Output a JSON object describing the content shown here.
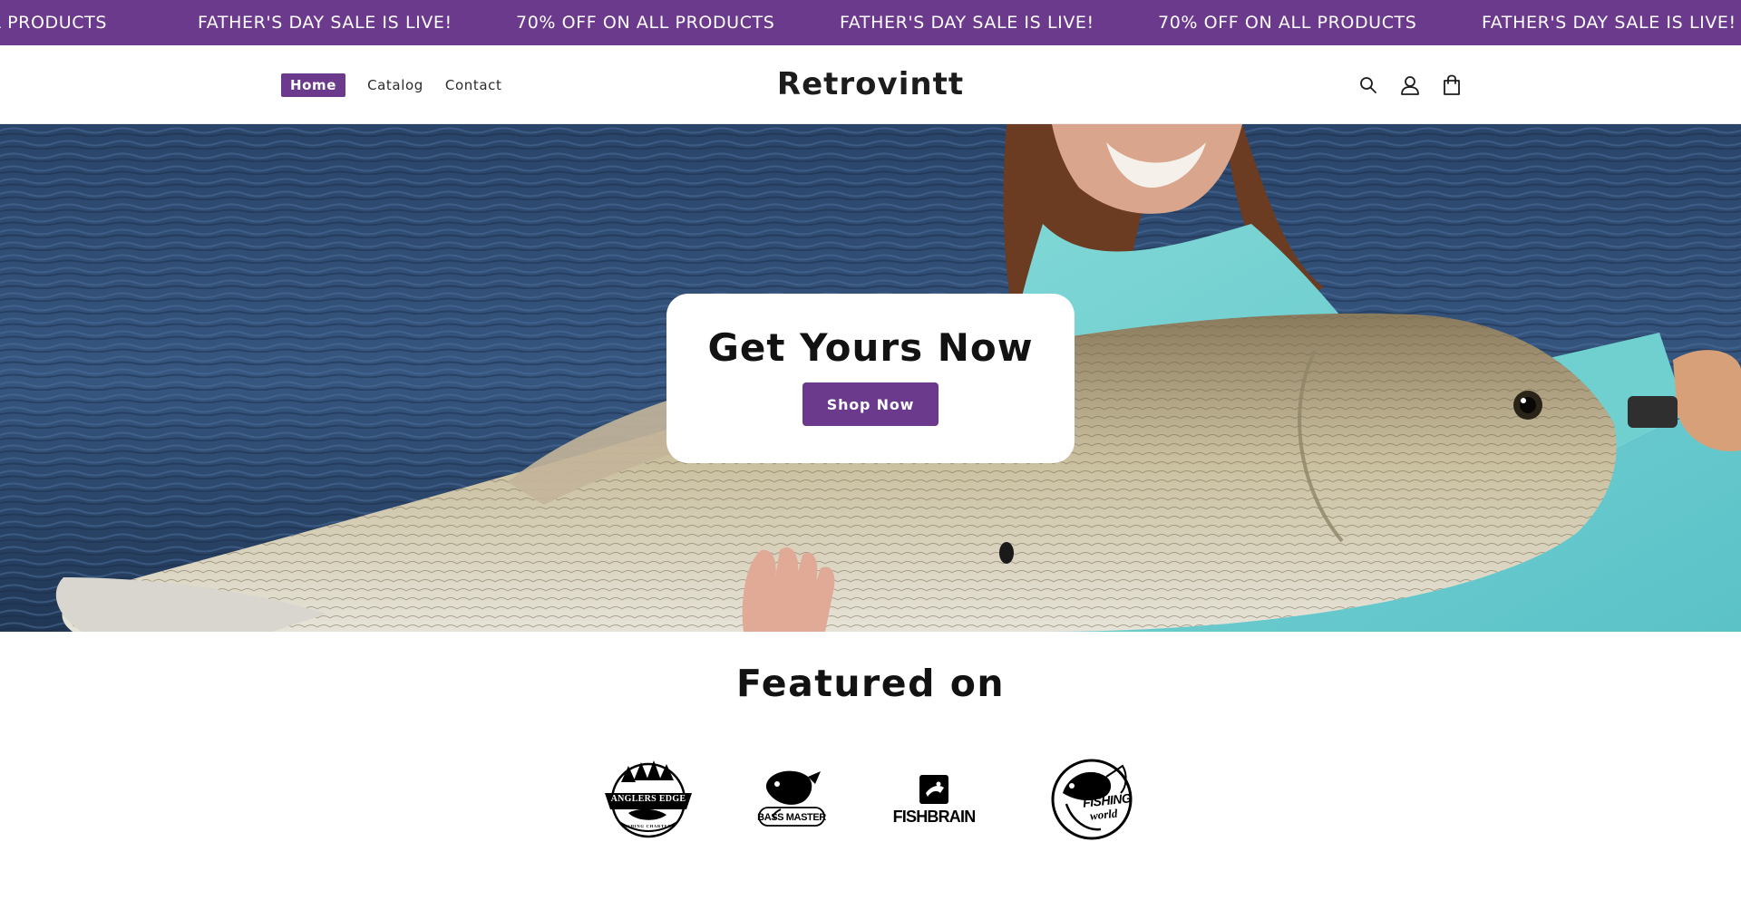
{
  "announcement": {
    "messages": [
      "70% OFF ON ALL PRODUCTS",
      "FATHER'S DAY SALE IS LIVE!",
      "70% OFF ON ALL PRODUCTS",
      "FATHER'S DAY SALE IS LIVE!",
      "70% OFF ON ALL PRODUCTS",
      "FATHER'S DAY SALE IS LIVE!"
    ],
    "background": "#6c3a8c"
  },
  "header": {
    "nav": [
      {
        "label": "Home",
        "active": true
      },
      {
        "label": "Catalog",
        "active": false
      },
      {
        "label": "Contact",
        "active": false
      }
    ],
    "logo": "Retrovintt",
    "icons": [
      "search-icon",
      "account-icon",
      "cart-icon"
    ]
  },
  "hero": {
    "title": "Get Yours Now",
    "button_label": "Shop Now"
  },
  "featured": {
    "title": "Featured on",
    "brands": [
      {
        "name": "ANGLERS EDGE",
        "subtitle": "FISHING CHARTERS"
      },
      {
        "name": "BASS MASTER"
      },
      {
        "name": "FISHBRAIN"
      },
      {
        "name": "FISHING",
        "subtitle": "world"
      }
    ]
  },
  "colors": {
    "accent": "#6c3a8c",
    "text": "#121212",
    "background": "#ffffff"
  }
}
